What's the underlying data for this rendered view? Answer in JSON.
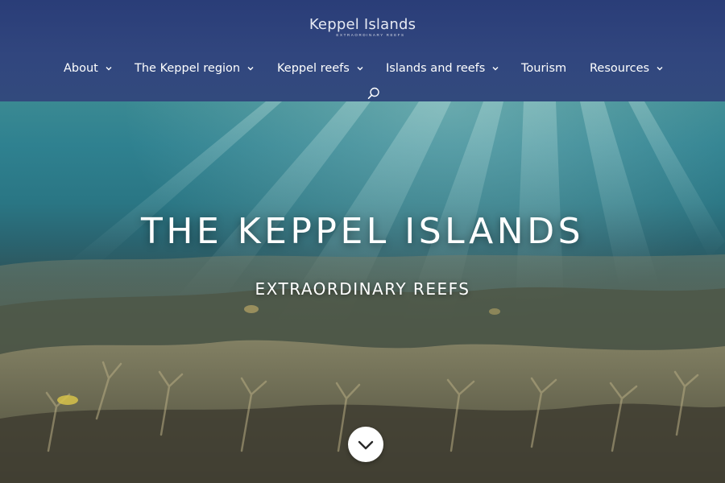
{
  "header": {
    "logo_title": "Keppel Islands",
    "logo_tagline": "EXTRAORDINARY REEFS",
    "nav": [
      {
        "label": "About",
        "has_dropdown": true
      },
      {
        "label": "The Keppel region",
        "has_dropdown": true
      },
      {
        "label": "Keppel reefs",
        "has_dropdown": true
      },
      {
        "label": "Islands and reefs",
        "has_dropdown": true
      },
      {
        "label": "Tourism",
        "has_dropdown": false
      },
      {
        "label": "Resources",
        "has_dropdown": true
      }
    ],
    "search_icon": "search-icon",
    "background_color": "#2f437c"
  },
  "hero": {
    "title": "THE KEPPEL ISLANDS",
    "subtitle": "EXTRAORDINARY REEFS",
    "scroll_icon": "chevron-down-icon",
    "background": "underwater coral reef photo"
  }
}
